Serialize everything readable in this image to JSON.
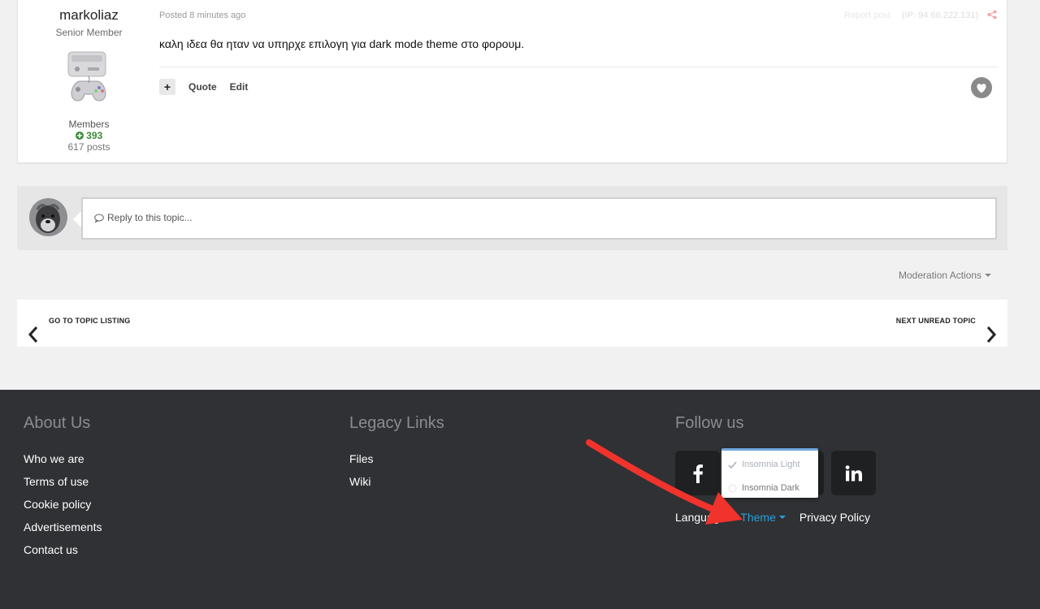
{
  "post": {
    "author_name": "markoliaz",
    "author_title": "Senior Member",
    "author_group": "Members",
    "author_rep": "393",
    "author_posts": "617 posts",
    "posted": "Posted 8 minutes ago",
    "report": "Report post",
    "ip": "(IP: 94.66.222.131)",
    "content": "καλη ιδεα θα ηταν να υπηρχε επιλογη για dark mode theme στο φορουμ.",
    "actions": {
      "plus": "+",
      "quote": "Quote",
      "edit": "Edit"
    }
  },
  "reply": {
    "placeholder": "Reply to this topic..."
  },
  "moderation": {
    "label": "Moderation Actions"
  },
  "topic_nav": {
    "prev": "GO TO TOPIC LISTING",
    "next": "NEXT UNREAD TOPIC"
  },
  "footer": {
    "about": {
      "heading": "About Us",
      "links": [
        "Who we are",
        "Terms of use",
        "Cookie policy",
        "Advertisements",
        "Contact us"
      ]
    },
    "legacy": {
      "heading": "Legacy Links",
      "links": [
        "Files",
        "Wiki"
      ]
    },
    "follow": {
      "heading": "Follow us"
    },
    "bottom_links": {
      "language": "Language",
      "theme": "Theme",
      "privacy": "Privacy Policy"
    },
    "theme_menu": {
      "options": [
        "Insomnia Light",
        "Insomnia Dark"
      ],
      "selected": "Insomnia Light"
    }
  },
  "colors": {
    "accent": "#2b9fd8",
    "footer_bg": "#2f3134",
    "arrow": "#f0332c"
  }
}
